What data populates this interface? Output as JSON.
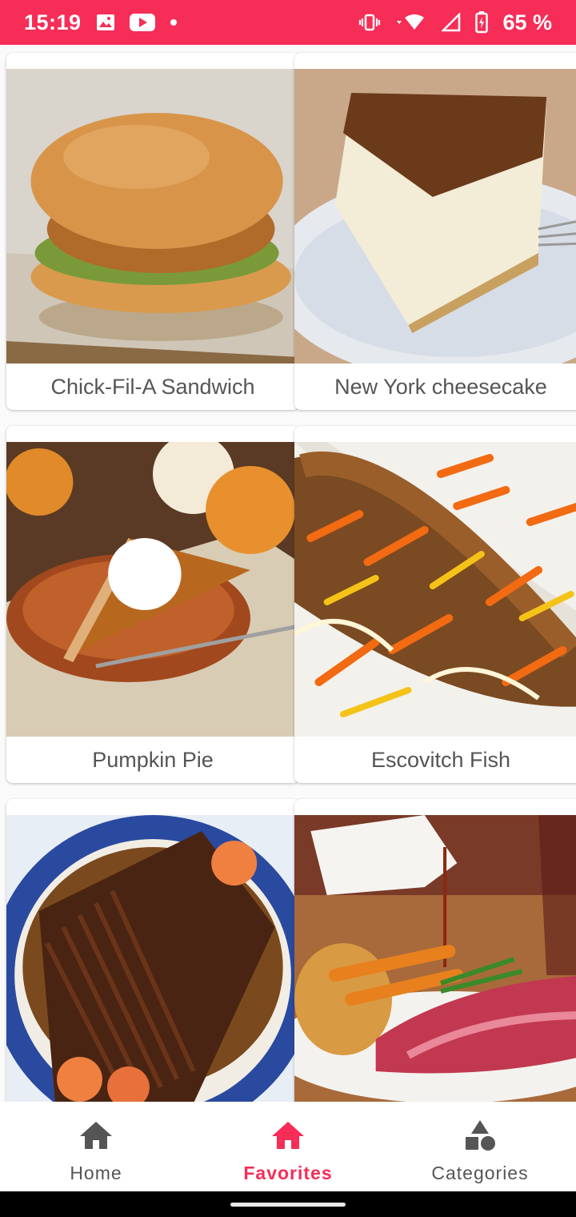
{
  "status_bar": {
    "time": "15:19",
    "battery": "65 %",
    "bg_color": "#f62d57",
    "icons_left": [
      "image-icon",
      "youtube-icon",
      "dot-icon"
    ],
    "icons_right": [
      "vibrate-icon",
      "wifi-icon",
      "signal-icon",
      "battery-icon"
    ]
  },
  "recipes": [
    {
      "title": "Chick-Fil-A Sandwich"
    },
    {
      "title": "New York cheesecake"
    },
    {
      "title": "Pumpkin Pie"
    },
    {
      "title": "Escovitch Fish"
    },
    {
      "title": ""
    },
    {
      "title": ""
    }
  ],
  "bottom_nav": {
    "items": [
      {
        "label": "Home",
        "icon": "home-icon"
      },
      {
        "label": "Favorites",
        "icon": "home-icon",
        "active": true
      },
      {
        "label": "Categories",
        "icon": "categories-icon"
      }
    ],
    "active_color": "#f62d57",
    "inactive_color": "#555555"
  }
}
